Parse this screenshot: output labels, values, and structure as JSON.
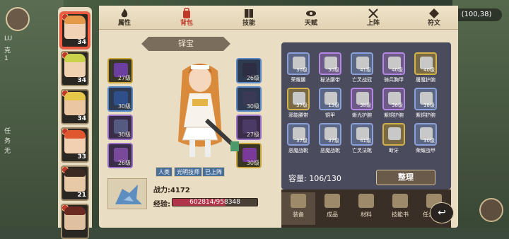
{
  "coordinates": "(100,38)",
  "left_panel": {
    "texts": [
      "LU",
      "克",
      "1",
      "任",
      "务",
      "无"
    ]
  },
  "tabs": [
    {
      "label": "属性",
      "icon": "flame-icon"
    },
    {
      "label": "背包",
      "icon": "backpack-icon",
      "active": true
    },
    {
      "label": "技能",
      "icon": "book-icon"
    },
    {
      "label": "天赋",
      "icon": "eye-icon"
    },
    {
      "label": "上阵",
      "icon": "crossed-swords-icon"
    },
    {
      "label": "符文",
      "icon": "rune-icon"
    }
  ],
  "heroes": [
    {
      "level": "34",
      "active": true,
      "hair": "#e59a4a",
      "face": "#f2d2b5"
    },
    {
      "level": "34",
      "hair": "#c9d24a",
      "face": "#f1d2b0"
    },
    {
      "level": "34",
      "hair": "#e6c74a",
      "face": "#eac6a2"
    },
    {
      "level": "33",
      "hair": "#e0562f",
      "face": "#f1d0b2"
    },
    {
      "level": "21",
      "hair": "#3a2a22",
      "face": "#e8c9a6"
    },
    {
      "level": "",
      "hair": "#6a2a22",
      "face": "#dfc0a0"
    }
  ],
  "character": {
    "title": "铎宝",
    "power_label": "战力:",
    "power_value": "4172",
    "exp_label": "经验:",
    "exp_value": "602814/958348",
    "exp_fraction": 0.629,
    "chips": [
      "人类",
      "光明技师",
      "已上阵"
    ]
  },
  "equip_slots": [
    {
      "level": "27级",
      "tier": "gold"
    },
    {
      "level": "30级",
      "tier": "blue"
    },
    {
      "level": "30级",
      "tier": "purple"
    },
    {
      "level": "26级",
      "tier": "purple"
    },
    {
      "level": "26级",
      "tier": "blue"
    },
    {
      "level": "30级",
      "tier": "blue"
    },
    {
      "level": "27级",
      "tier": "purple"
    },
    {
      "level": "30级",
      "tier": "gold"
    }
  ],
  "bag": {
    "items": [
      {
        "name": "荣耀腰",
        "level": "30级",
        "tier": "blue"
      },
      {
        "name": "秘法腰带",
        "level": "50级",
        "tier": "purple"
      },
      {
        "name": "亡灵战冠",
        "level": "41级",
        "tier": "blue"
      },
      {
        "name": "骑兵胸甲",
        "level": "40级",
        "tier": "purple"
      },
      {
        "name": "屠魔护腕",
        "level": "40级",
        "tier": "gold"
      },
      {
        "name": "邪能腰带",
        "level": "37级",
        "tier": "gold"
      },
      {
        "name": "铜甲",
        "level": "13级",
        "tier": "blue"
      },
      {
        "name": "蜥光护腕",
        "level": "38级",
        "tier": "purple"
      },
      {
        "name": "紫铜护腕",
        "level": "38级",
        "tier": "purple"
      },
      {
        "name": "紫铜护腕",
        "level": "38级",
        "tier": "blue"
      },
      {
        "name": "恶魔战靴",
        "level": "37级",
        "tier": "blue"
      },
      {
        "name": "恶魔战靴",
        "level": "37级",
        "tier": "blue"
      },
      {
        "name": "亡灵法靴",
        "level": "41级",
        "tier": "blue"
      },
      {
        "name": "断牙",
        "level": "",
        "tier": "gold"
      },
      {
        "name": "荣耀战甲",
        "level": "30级",
        "tier": "blue"
      }
    ],
    "capacity_label": "容量:",
    "capacity_value": "106/130",
    "sort_label": "整理"
  },
  "bottom_tabs": [
    {
      "label": "装备",
      "active": true
    },
    {
      "label": "成品"
    },
    {
      "label": "材料"
    },
    {
      "label": "技能书"
    },
    {
      "label": "任务物品"
    }
  ],
  "back_label": "↩"
}
